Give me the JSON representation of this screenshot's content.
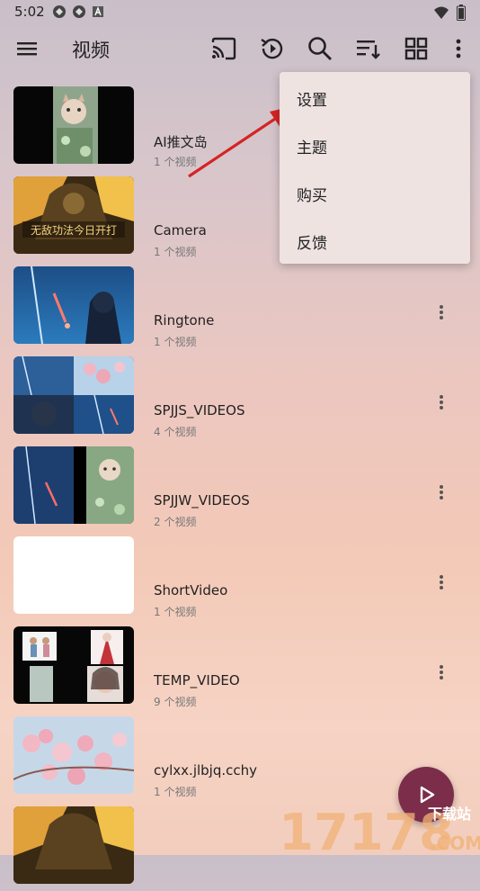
{
  "status_bar": {
    "time": "5:02"
  },
  "toolbar": {
    "title": "视频",
    "icons": [
      "menu-icon",
      "cast-icon",
      "history-icon",
      "search-icon",
      "sort-icon",
      "grid-view-icon",
      "more-vert-icon"
    ]
  },
  "folders": [
    {
      "name": "AI推文岛",
      "count": "1 个视频"
    },
    {
      "name": "Camera",
      "count": "1 个视频"
    },
    {
      "name": "Ringtone",
      "count": "1 个视频"
    },
    {
      "name": "SPJJS_VIDEOS",
      "count": "4 个视频"
    },
    {
      "name": "SPJJW_VIDEOS",
      "count": "2 个视频"
    },
    {
      "name": "ShortVideo",
      "count": "1 个视频"
    },
    {
      "name": "TEMP_VIDEO",
      "count": "9 个视频"
    },
    {
      "name": "cylxx.jlbjq.cchy",
      "count": "1 个视频"
    }
  ],
  "menu": {
    "items": [
      "设置",
      "主题",
      "购买",
      "反馈"
    ]
  },
  "thumb_overlay": {
    "caption": "无敌功法今日开打"
  },
  "watermark": {
    "text": "17178",
    "sub": "下载站",
    "domain": ".COM"
  },
  "colors": {
    "fab": "#7b2d4a",
    "arrow": "#d42424"
  }
}
